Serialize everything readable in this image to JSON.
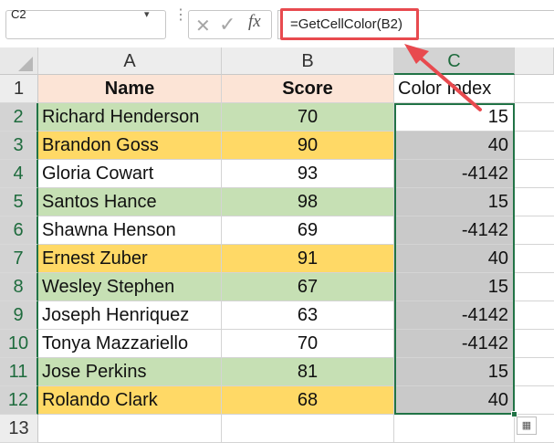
{
  "name_box": {
    "value": "C2"
  },
  "formula_bar": {
    "formula": "=GetCellColor(B2)",
    "cancel_icon": "✕",
    "enter_icon": "✓",
    "fx_label": "fx"
  },
  "columns": [
    {
      "label": "A",
      "selected": false
    },
    {
      "label": "B",
      "selected": false
    },
    {
      "label": "C",
      "selected": true
    }
  ],
  "row_numbers": [
    "1",
    "2",
    "3",
    "4",
    "5",
    "6",
    "7",
    "8",
    "9",
    "10",
    "11",
    "12",
    "13"
  ],
  "table": {
    "headers": [
      "Name",
      "Score",
      "Color Index"
    ],
    "rows": [
      {
        "name": "Richard Henderson",
        "score": "70",
        "index": "15",
        "fill": "#c6e0b4"
      },
      {
        "name": "Brandon Goss",
        "score": "90",
        "index": "40",
        "fill": "#ffd966"
      },
      {
        "name": "Gloria Cowart",
        "score": "93",
        "index": "-4142",
        "fill": "#ffffff"
      },
      {
        "name": "Santos Hance",
        "score": "98",
        "index": "15",
        "fill": "#c6e0b4"
      },
      {
        "name": "Shawna Henson",
        "score": "69",
        "index": "-4142",
        "fill": "#ffffff"
      },
      {
        "name": "Ernest Zuber",
        "score": "91",
        "index": "40",
        "fill": "#ffd966"
      },
      {
        "name": "Wesley Stephen",
        "score": "67",
        "index": "15",
        "fill": "#c6e0b4"
      },
      {
        "name": "Joseph Henriquez",
        "score": "63",
        "index": "-4142",
        "fill": "#ffffff"
      },
      {
        "name": "Tonya Mazzariello",
        "score": "70",
        "index": "-4142",
        "fill": "#ffffff"
      },
      {
        "name": "Jose Perkins",
        "score": "81",
        "index": "15",
        "fill": "#c6e0b4"
      },
      {
        "name": "Rolando Clark",
        "score": "68",
        "index": "40",
        "fill": "#ffd966"
      }
    ]
  },
  "colors": {
    "header_fill": "#fce4d6",
    "selection_fill": "#c9c9c9",
    "selection_border": "#217346",
    "annotation_red": "#e84a4f"
  },
  "icons": {
    "namebox_dropdown": "chevron-down-icon",
    "quick_analysis": "quick-analysis-icon"
  }
}
